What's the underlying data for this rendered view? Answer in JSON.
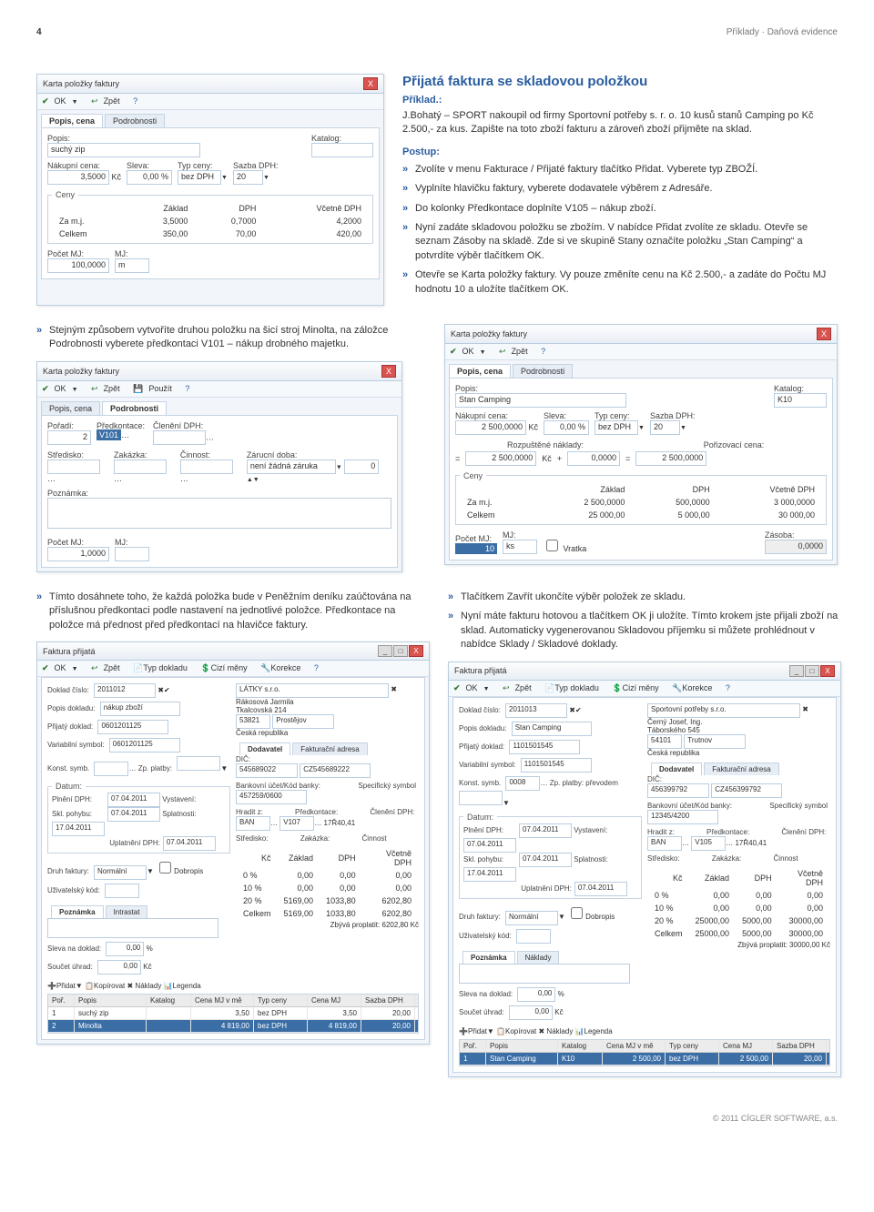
{
  "header": {
    "page": "4",
    "section": "Příklady · Daňová evidence"
  },
  "article": {
    "title": "Přijatá faktura se skladovou položkou",
    "exampleLabel": "Příklad.:",
    "exampleBody": "J.Bohatý – SPORT nakoupil od firmy Sportovní potřeby s. r. o. 10 kusů stanů Camping po Kč 2.500,- za kus. Zapište na toto zboží fakturu a zároveň zboží přijměte na sklad.",
    "postupLabel": "Postup:",
    "steps": [
      "Zvolíte v menu Fakturace / Přijaté faktury tlačítko Přidat. Vyberete typ ZBOŽÍ.",
      "Vyplníte hlavičku faktury, vyberete dodavatele výběrem z Adresáře.",
      "Do kolonky Předkontace doplníte V105 – nákup zboží.",
      "Nyní zadáte skladovou položku se zbožím. V nabídce Přidat zvolíte ze skladu. Otevře se seznam Zásoby na skladě. Zde si ve skupině Stany označíte položku „Stan Camping“ a potvrdíte výběr tlačítkem OK.",
      "Otevře se Karta položky faktury. Vy pouze změníte cenu na Kč 2.500,- a zadáte do Počtu MJ hodnotu 10 a uložíte tlačítkem OK."
    ]
  },
  "midLeftIntro": "Stejným způsobem vytvoříte druhou položku na šicí stroj Minolta, na záložce Podrobnosti vyberete předkontaci V101 – nákup drobného majetku.",
  "botLeftIntro": "Tímto dosáhnete toho, že každá položka bude v Peněžním deníku zaúčtována na příslušnou předkontaci podle nastavení na jednotlivé položce. Předkontace na položce má přednost před předkontací na hlavičce faktury.",
  "botRightSteps": [
    "Tlačítkem Zavřít ukončíte výběr položek ze skladu.",
    "Nyní máte fakturu hotovou a tlačítkem OK ji uložíte. Tímto krokem jste přijali zboží na sklad. Automaticky vygenerovanou Skladovou příjemku si můžete prohlédnout v nabídce Sklady / Skladové doklady."
  ],
  "footer": "© 2011 CÍGLER SOFTWARE, a.s.",
  "shot1": {
    "title": "Karta položky faktury",
    "tb": {
      "ok": "OK",
      "zpet": "Zpět"
    },
    "tabs": [
      "Popis, cena",
      "Podrobnosti"
    ],
    "popisLbl": "Popis:",
    "popisVal": "suchý zip",
    "katalogLbl": "Katalog:",
    "nakupLbl": "Nákupní cena:",
    "nakupVal": "3,5000",
    "nakupKc": "Kč",
    "slevaLbl": "Sleva:",
    "slevaVal": "0,00 %",
    "typLbl": "Typ ceny:",
    "typVal": "bez DPH",
    "sazbaLbl": "Sazba DPH:",
    "sazbaVal": "20",
    "cenyLeg": "Ceny",
    "hdr": [
      "",
      "Základ",
      "DPH",
      "Včetně DPH"
    ],
    "r1": [
      "Za m.j.",
      "3,5000",
      "0,7000",
      "4,2000"
    ],
    "r2": [
      "Celkem",
      "350,00",
      "70,00",
      "420,00"
    ],
    "pocetLbl": "Počet MJ:",
    "pocetVal": "100,0000",
    "mjLbl": "MJ:",
    "mjVal": "m"
  },
  "shot2": {
    "title": "Karta položky faktury",
    "tb": {
      "ok": "OK",
      "zpet": "Zpět",
      "pouzit": "Použít"
    },
    "tabs": [
      "Popis, cena",
      "Podrobnosti"
    ],
    "poradiLbl": "Pořadí:",
    "poradiVal": "2",
    "predkLbl": "Předkontace:",
    "predkVal": "V101",
    "clenLbl": "Členění DPH:",
    "stredLbl": "Středisko:",
    "zakLbl": "Zakázka:",
    "cinLbl": "Činnost:",
    "zarLbl": "Zárucní doba:",
    "zarVal": "není žádná záruka",
    "poznLbl": "Poznámka:",
    "pocetLbl": "Počet MJ:",
    "pocetVal": "1,0000",
    "mjLbl": "MJ:"
  },
  "shot3": {
    "title": "Karta položky faktury",
    "tb": {
      "ok": "OK",
      "zpet": "Zpět"
    },
    "tabs": [
      "Popis, cena",
      "Podrobnosti"
    ],
    "popisLbl": "Popis:",
    "popisVal": "Stan Camping",
    "katalogLbl": "Katalog:",
    "katalogVal": "K10",
    "nakupLbl": "Nákupní cena:",
    "nakupVal": "2 500,0000",
    "nakupKc": "Kč",
    "slevaLbl": "Sleva:",
    "slevaVal": "0,00 %",
    "typLbl": "Typ ceny:",
    "typVal": "bez DPH",
    "sazbaLbl": "Sazba DPH:",
    "sazbaVal": "20",
    "rozpLbl": "Rozpuštěné náklady:",
    "rozpKc": "Kč",
    "rozpVal": "0,0000",
    "rozp2": "2 500,0000",
    "porLbl": "Pořizovací cena:",
    "porVal": "2 500,0000",
    "cenyLeg": "Ceny",
    "hdr": [
      "",
      "Základ",
      "DPH",
      "Včetně DPH"
    ],
    "r1": [
      "Za m.j.",
      "2 500,0000",
      "500,0000",
      "3 000,0000"
    ],
    "r2": [
      "Celkem",
      "25 000,00",
      "5 000,00",
      "30 000,00"
    ],
    "pocetLbl": "Počet MJ:",
    "pocetVal": "10",
    "mjLbl": "MJ:",
    "mjVal": "ks",
    "vratkaLbl": "Vratka",
    "zasobaLbl": "Zásoba:",
    "zasobaVal": "0,0000"
  },
  "shot4": {
    "title": "Faktura přijatá",
    "tb": {
      "ok": "OK",
      "zpet": "Zpět",
      "typ": "Typ dokladu",
      "cizi": "Cizí měny",
      "kor": "Korekce"
    },
    "docNumLbl": "Doklad číslo:",
    "docNumVal": "2011012",
    "popDokLbl": "Popis dokladu:",
    "popDokVal": "nákup zboží",
    "prijLbl": "Přijatý doklad:",
    "prijVal": "0601201125",
    "varLbl": "Variabilní symbol:",
    "varVal": "0601201125",
    "konstLbl": "Konst. symb.",
    "konstVal": "",
    "zpLbl": "Zp. platby:",
    "datumLeg": "Datum:",
    "vystLbl": "Vystavení:",
    "plnLbl": "Plnění DPH:",
    "plnVal": "07.04.2011",
    "splLbl": "Splatnosti:",
    "splVal": "17.04.2011",
    "sklLbl": "Skl. pohybu:",
    "sklVal": "07.04.2011",
    "uplLbl": "Uplatnění DPH:",
    "uplVal": "07.04.2011",
    "druhLbl": "Druh faktury:",
    "druhVal": "Normální",
    "dobLbl": "Dobropis",
    "uzivLbl": "Uživatelský kód:",
    "poznLbl": "Poznámka",
    "poznTab": "Intrastat",
    "slevaLbl": "Sleva na doklad:",
    "slevaVal": "0,00",
    "slevaPct": "%",
    "soucetLbl": "Součet úhrad:",
    "soucetVal": "0,00",
    "soucetKc": "Kč",
    "dod": {
      "name": "LÁTKY s.r.o.",
      "l1": "Rákosová Jarmila",
      "l2": "Tkalcovská 214",
      "psc": "53821",
      "mesto": "Prostějov",
      "stat": "Česká republika"
    },
    "dodTab": [
      "Dodavatel",
      "Fakturační adresa"
    ],
    "dicLbl": "DIČ:",
    "dicVal": "545689022",
    "dic2Val": "CZ545689222",
    "ucetLbl": "Bankovní účet/Kód banky:",
    "ucetVal": "457259/0600",
    "specLbl": "Specifický symbol",
    "hradLbl": "Hradit z:",
    "hradVal": "BAN",
    "predkLbl": "Předkontace:",
    "predkVal": "V107",
    "predkDet": "17Ř40,41",
    "clenLbl": "Členění DPH:",
    "stredLbl": "Středisko:",
    "zakLbl": "Zakázka:",
    "cinLbl": "Činnost",
    "sumHdr": [
      "Kč",
      "Základ",
      "DPH",
      "Včetně DPH"
    ],
    "sum": [
      [
        "0 %",
        "0,00",
        "0,00",
        "0,00"
      ],
      [
        "10 %",
        "0,00",
        "0,00",
        "0,00"
      ],
      [
        "20 %",
        "5169,00",
        "1033,80",
        "6202,80"
      ],
      [
        "Celkem",
        "5169,00",
        "1033,80",
        "6202,80"
      ]
    ],
    "zbyvaLbl": "Zbývá proplatit:",
    "zbyvaVal": "6202,80",
    "zbyvaKc": "Kč",
    "pridatLbl": "Přidat",
    "kopLbl": "Kopírovat",
    "nakLbl": "Náklady",
    "legLbl": "Legenda",
    "gridHdr": [
      "Poř.",
      "Popis",
      "Katalog",
      "Cena MJ v mě",
      "Typ ceny",
      "Cena MJ",
      "Sazba DPH"
    ],
    "gridR1": [
      "1",
      "suchý zip",
      "",
      "3,50",
      "bez DPH",
      "3,50",
      "20,00"
    ],
    "gridR2": [
      "2",
      "Minolta",
      "",
      "4 819,00",
      "bez DPH",
      "4 819,00",
      "20,00"
    ]
  },
  "shot5": {
    "title": "Faktura přijatá",
    "tb": {
      "ok": "OK",
      "zpet": "Zpět",
      "typ": "Typ dokladu",
      "cizi": "Cizí měny",
      "kor": "Korekce"
    },
    "docNumLbl": "Doklad číslo:",
    "docNumVal": "2011013",
    "popDokLbl": "Popis dokladu:",
    "popDokVal": "Stan Camping",
    "prijLbl": "Přijatý doklad:",
    "prijVal": "1101501545",
    "varLbl": "Variabilní symbol:",
    "varVal": "1101501545",
    "konstLbl": "Konst. symb.",
    "konstVal": "0008",
    "zpLbl": "Zp. platby: převodem",
    "datumLeg": "Datum:",
    "vystLbl": "Vystavení:",
    "vystVal": "07.04.2011",
    "plnLbl": "Plnění DPH:",
    "plnVal": "07.04.2011",
    "splLbl": "Splatnosti:",
    "splVal": "17.04.2011",
    "sklLbl": "Skl. pohybu:",
    "sklVal": "07.04.2011",
    "uplLbl": "Uplatnění DPH:",
    "uplVal": "07.04.2011",
    "druhLbl": "Druh faktury:",
    "druhVal": "Normální",
    "dobLbl": "Dobropis",
    "uzivLbl": "Uživatelský kód:",
    "poznLbl": "Poznámka",
    "poznTab": "Náklady",
    "slevaLbl": "Sleva na doklad:",
    "slevaVal": "0,00",
    "slevaPct": "%",
    "soucetLbl": "Součet úhrad:",
    "soucetVal": "0,00",
    "soucetKc": "Kč",
    "dod": {
      "name": "Sportovní potřeby s.r.o.",
      "l1": "Černý Josef, Ing.",
      "l2": "Táborského 545",
      "psc": "54101",
      "mesto": "Trutnov",
      "stat": "Česká republika"
    },
    "dodTab": [
      "Dodavatel",
      "Fakturační adresa"
    ],
    "dicLbl": "DIČ:",
    "dicVal": "456399792",
    "dic2Val": "CZ456399792",
    "ucetLbl": "Bankovní účet/Kód banky:",
    "ucetVal": "12345/4200",
    "specLbl": "Specifický symbol",
    "hradLbl": "Hradit z:",
    "hradVal": "BAN",
    "predkLbl": "Předkontace:",
    "predkVal": "V105",
    "predkDet": "17Ř40,41",
    "clenLbl": "Členění DPH:",
    "stredLbl": "Středisko:",
    "zakLbl": "Zakázka:",
    "cinLbl": "Činnost",
    "sumHdr": [
      "Kč",
      "Základ",
      "DPH",
      "Včetně DPH"
    ],
    "sum": [
      [
        "0 %",
        "0,00",
        "0,00",
        "0,00"
      ],
      [
        "10 %",
        "0,00",
        "0,00",
        "0,00"
      ],
      [
        "20 %",
        "25000,00",
        "5000,00",
        "30000,00"
      ],
      [
        "Celkem",
        "25000,00",
        "5000,00",
        "30000,00"
      ]
    ],
    "zbyvaLbl": "Zbývá proplatit:",
    "zbyvaVal": "30000,00",
    "zbyvaKc": "Kč",
    "pridatLbl": "Přidat",
    "kopLbl": "Kopírovat",
    "nakLbl": "Náklady",
    "legLbl": "Legenda",
    "gridHdr": [
      "Poř.",
      "Popis",
      "Katalog",
      "Cena MJ v mě",
      "Typ ceny",
      "Cena MJ",
      "Sazba DPH"
    ],
    "gridR1": [
      "1",
      "Stan Camping",
      "K10",
      "2 500,00",
      "bez DPH",
      "2 500,00",
      "20,00"
    ]
  }
}
